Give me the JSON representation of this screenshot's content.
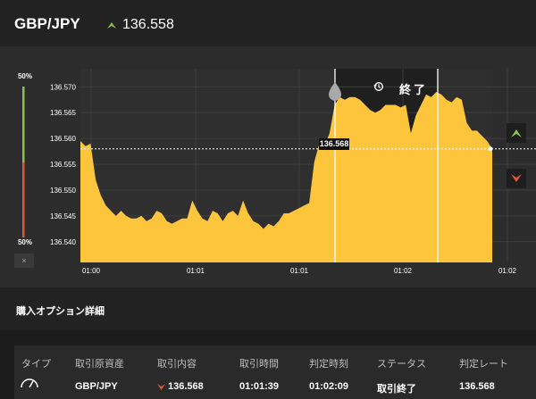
{
  "header": {
    "pair": "GBP/JPY",
    "price": "136.558",
    "arrow_icon": "up-arrow-icon",
    "arrow_color": "#8bc34a"
  },
  "payout": {
    "up_label": "50%",
    "down_label": "50%",
    "up_color": "#8bc34a",
    "down_color": "#e2553b",
    "close_label": "×"
  },
  "chart_data": {
    "type": "area",
    "pair": "GBP/JPY",
    "y_ticks": [
      "136.570",
      "136.565",
      "136.560",
      "136.555",
      "136.550",
      "136.545",
      "136.540"
    ],
    "ylim": [
      136.536,
      136.5735
    ],
    "x_ticks": [
      "01:00",
      "01:01",
      "01:01",
      "01:02",
      "01:02"
    ],
    "series": [
      {
        "values": [
          136.5595,
          136.5585,
          136.559,
          136.552,
          136.549,
          136.547,
          136.546,
          136.545,
          136.546,
          136.545,
          136.5445,
          136.5445,
          136.545,
          136.544,
          136.5445,
          136.546,
          136.5455,
          136.544,
          136.5435,
          136.544,
          136.5445,
          136.5445,
          136.548,
          136.546,
          136.5445,
          136.544,
          136.546,
          136.5455,
          136.544,
          136.5455,
          136.546,
          136.545,
          136.548,
          136.5455,
          136.544,
          136.5435,
          136.5425,
          136.5435,
          136.543,
          136.544,
          136.5455,
          136.5455,
          136.546,
          136.5465,
          136.547,
          136.5475,
          136.5555,
          136.559,
          136.5585,
          136.561,
          136.5665,
          136.568,
          136.5675,
          136.568,
          136.568,
          136.5675,
          136.5665,
          136.5655,
          136.565,
          136.5655,
          136.5665,
          136.5665,
          136.5665,
          136.566,
          136.5665,
          136.561,
          136.5645,
          136.5665,
          136.5685,
          136.568,
          136.569,
          136.5685,
          136.5675,
          136.567,
          136.568,
          136.5675,
          136.563,
          136.5615,
          136.5615,
          136.5605,
          136.5595,
          136.558
        ]
      }
    ],
    "current_rate": "136.558",
    "entry_marker_label": "136.568",
    "end_label": "終了",
    "end_icon": "history-icon",
    "fill_color": "#fcc53c",
    "grid": true
  },
  "details": {
    "title": "購入オプション詳細",
    "columns": [
      "タイプ",
      "取引原資産",
      "取引内容",
      "取引時間",
      "判定時刻",
      "ステータス",
      "判定レート"
    ],
    "row": {
      "type_icon": "gauge-icon",
      "asset": "GBP/JPY",
      "content_icon": "down-arrow-icon",
      "content": "136.568",
      "trade_time": "01:01:39",
      "judge_time": "01:02:09",
      "status": "取引終了",
      "judge_rate": "136.568"
    }
  }
}
